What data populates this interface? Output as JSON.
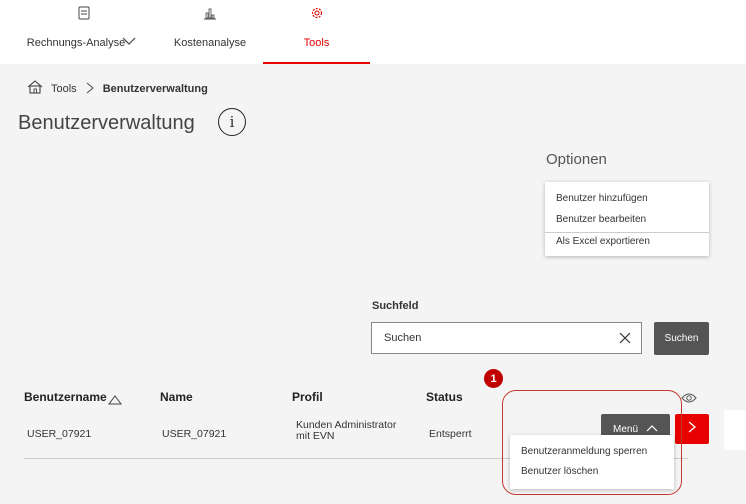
{
  "nav": {
    "items": [
      {
        "label": "Rechnungs-Analyse",
        "icon": "document-icon"
      },
      {
        "label": "Kostenanalyse",
        "icon": "bar-chart-icon"
      },
      {
        "label": "Tools",
        "icon": "gear-icon",
        "active": true
      }
    ]
  },
  "breadcrumb": {
    "root": "Tools",
    "current": "Benutzerverwaltung"
  },
  "page": {
    "title": "Benutzerverwaltung",
    "info_glyph": "i"
  },
  "options": {
    "title": "Optionen",
    "items": [
      "Benutzer hinzufügen",
      "Benutzer bearbeiten",
      "Als Excel exportieren"
    ]
  },
  "search": {
    "label": "Suchfeld",
    "value": "Suchen",
    "button": "Suchen"
  },
  "table": {
    "headers": [
      "Benutzername",
      "Name",
      "Profil",
      "Status"
    ],
    "rows": [
      {
        "username": "USER_07921",
        "name": "USER_07921",
        "profile": "Kunden Administrator mit EVN",
        "status": "Entsperrt"
      }
    ]
  },
  "row_actions": {
    "menu_label": "Menü",
    "menu_items": [
      "Benutzeranmeldung sperren",
      "Benutzer löschen"
    ]
  },
  "annotation": {
    "badge": "1"
  },
  "colors": {
    "accent": "#e60000",
    "dark_button": "#555555",
    "highlight": "#c0392b"
  }
}
